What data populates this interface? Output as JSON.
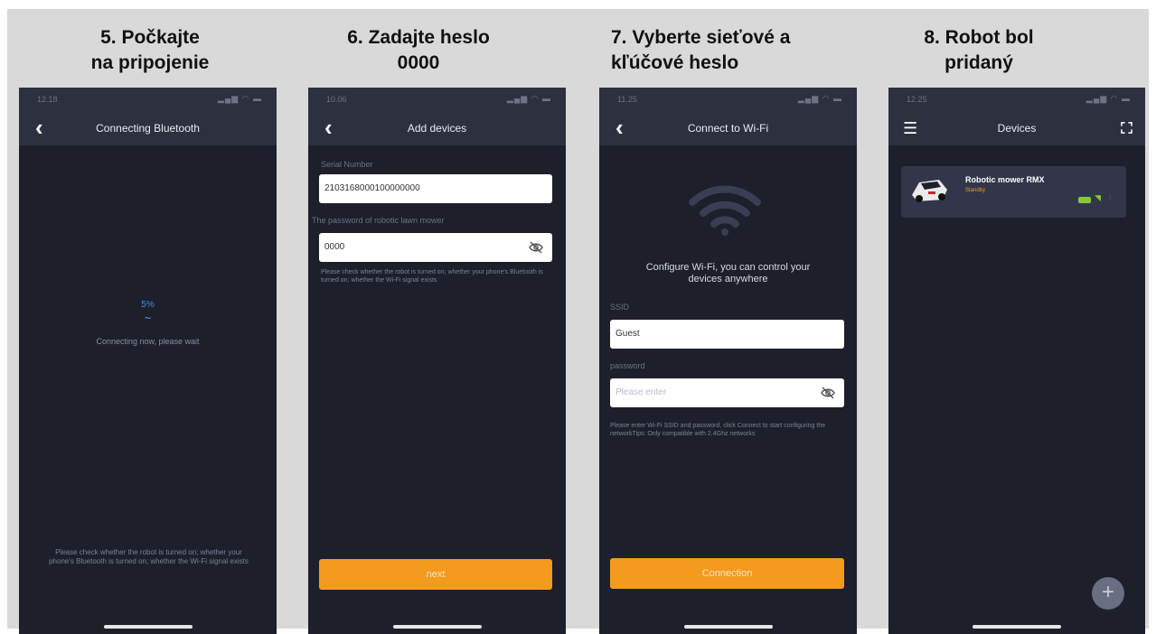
{
  "steps": [
    {
      "heading": "5. Počkajte\nna pripojenie",
      "time": "12.18",
      "nav_title": "Connecting Bluetooth",
      "progress": "5%",
      "progress_dash": "~",
      "waiting_text": "Connecting now, please wait",
      "bottom_hint": "Please check whether the robot is turned on; whether your phone's Bluetooth is turned on; whether the Wi-Fi signal exists"
    },
    {
      "heading": "6. Zadajte heslo\n0000",
      "time": "10.06",
      "nav_title": "Add devices",
      "serial_label": "Serial Number",
      "serial_value": "2103168000100000000",
      "password_label": "The password of robotic lawn mower",
      "password_value": "0000",
      "hint": "Please check whether the robot is turned on; whether your phone's Bluetooth is turned on; whether the Wi-Fi signal exists",
      "button_label": "next"
    },
    {
      "heading": "7. Vyberte sieťové a\nkľúčové heslo",
      "time": "11.25",
      "nav_title": "Connect to Wi-Fi",
      "configure_text": "Configure Wi-Fi, you can control your devices anywhere",
      "ssid_label": "SSID",
      "ssid_value": "Guest",
      "password_label": "password",
      "password_placeholder": "Please enter",
      "hint": "Please enter Wi-Fi SSID and password, click Connect to start configuring the networkTips: Only compatible with 2.4Ghz networks",
      "button_label": "Connection"
    },
    {
      "heading": "8. Robot bol\npridaný",
      "time": "12.25",
      "nav_title": "Devices",
      "device_name": "Robotic mower RMX",
      "device_status": "Standby",
      "add_label": "+"
    }
  ],
  "colors": {
    "background": "#d9d9d9",
    "phone_bg": "#1d1f2b",
    "bar_bg": "#2d303f",
    "accent_orange": "#f39a1f",
    "progress_blue": "#3f8ee8",
    "battery_green": "#86c93a"
  },
  "icons": [
    "back-chevron-icon",
    "eye-off-icon",
    "wifi-icon",
    "menu-icon",
    "fullscreen-icon",
    "battery-icon",
    "plus-icon",
    "mower-icon"
  ]
}
